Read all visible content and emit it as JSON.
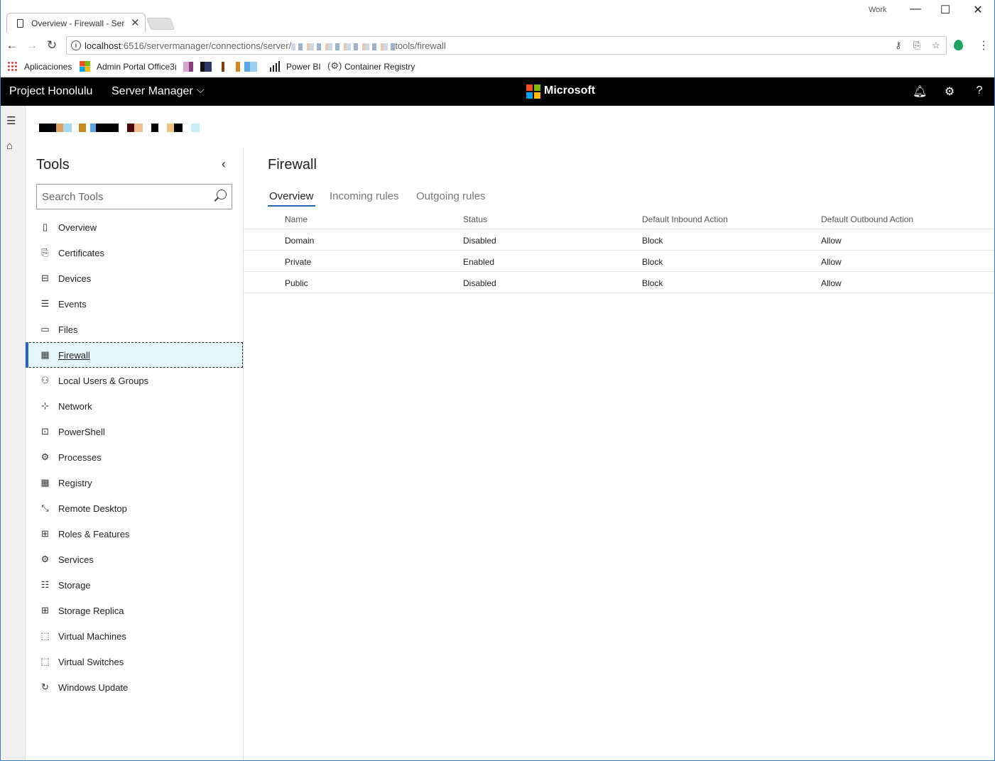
{
  "browser": {
    "tab_title": "Overview - Firewall - Ser",
    "profile_label": "Work",
    "url_host": "localhost",
    "url_path_prefix": ":6516/servermanager/connections/server/",
    "url_path_suffix": "tools/firewall",
    "bookmarks": [
      {
        "label": "Aplicaciones",
        "icon": "apps-grid-icon"
      },
      {
        "label": "Admin Portal Office3(",
        "icon": "microsoft-logo-icon"
      },
      {
        "label": "Power BI",
        "icon": "power-bi-icon"
      },
      {
        "label": "Container Registry",
        "icon": "container-registry-icon"
      }
    ]
  },
  "app": {
    "brand": "Project Honolulu",
    "app_name": "Server Manager",
    "vendor": "Microsoft"
  },
  "tools": {
    "title": "Tools",
    "search_placeholder": "Search Tools",
    "items": [
      {
        "label": "Overview",
        "icon": "overview-icon",
        "glyph": "▯"
      },
      {
        "label": "Certificates",
        "icon": "certificate-icon",
        "glyph": "⎘"
      },
      {
        "label": "Devices",
        "icon": "devices-icon",
        "glyph": "⊟"
      },
      {
        "label": "Events",
        "icon": "events-icon",
        "glyph": "☰"
      },
      {
        "label": "Files",
        "icon": "files-icon",
        "glyph": "▭"
      },
      {
        "label": "Firewall",
        "icon": "firewall-icon",
        "glyph": "▦"
      },
      {
        "label": "Local Users & Groups",
        "icon": "users-icon",
        "glyph": "⚇"
      },
      {
        "label": "Network",
        "icon": "network-icon",
        "glyph": "⊹"
      },
      {
        "label": "PowerShell",
        "icon": "powershell-icon",
        "glyph": "⊡"
      },
      {
        "label": "Processes",
        "icon": "processes-icon",
        "glyph": "⚙"
      },
      {
        "label": "Registry",
        "icon": "registry-icon",
        "glyph": "▦"
      },
      {
        "label": "Remote Desktop",
        "icon": "remote-desktop-icon",
        "glyph": "⤡"
      },
      {
        "label": "Roles & Features",
        "icon": "roles-features-icon",
        "glyph": "⊞"
      },
      {
        "label": "Services",
        "icon": "services-icon",
        "glyph": "⚙"
      },
      {
        "label": "Storage",
        "icon": "storage-icon",
        "glyph": "☷"
      },
      {
        "label": "Storage Replica",
        "icon": "storage-replica-icon",
        "glyph": "⊞"
      },
      {
        "label": "Virtual Machines",
        "icon": "virtual-machines-icon",
        "glyph": "⬚"
      },
      {
        "label": "Virtual Switches",
        "icon": "virtual-switches-icon",
        "glyph": "⬚"
      },
      {
        "label": "Windows Update",
        "icon": "windows-update-icon",
        "glyph": "↻"
      }
    ],
    "active_index": 5
  },
  "main": {
    "title": "Firewall",
    "tabs": [
      "Overview",
      "Incoming rules",
      "Outgoing rules"
    ],
    "active_tab": 0,
    "columns": [
      "Name",
      "Status",
      "Default Inbound Action",
      "Default Outbound Action"
    ],
    "rows": [
      [
        "Domain",
        "Disabled",
        "Block",
        "Allow"
      ],
      [
        "Private",
        "Enabled",
        "Block",
        "Allow"
      ],
      [
        "Public",
        "Disabled",
        "Block",
        "Allow"
      ]
    ]
  },
  "colors": {
    "accent": "#2a62b8",
    "appbar_bg": "#000000",
    "active_item_bg": "#e6f6fd"
  }
}
